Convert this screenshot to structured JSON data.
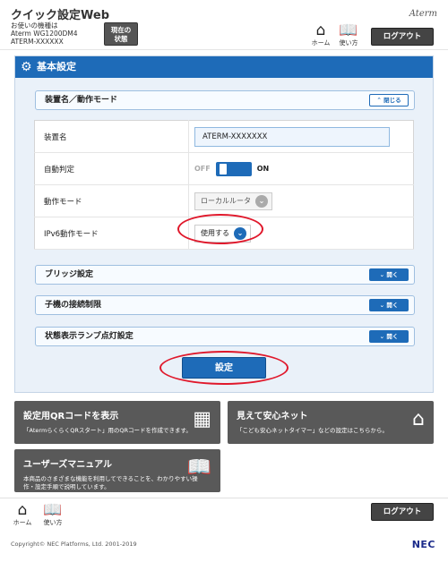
{
  "header": {
    "app_title": "クイック設定Web",
    "device_label": "お使いの機種は",
    "device_model": "Aterm WG1200DM4",
    "device_name": "ATERM-XXXXXX",
    "status_button_line1": "現在の",
    "status_button_line2": "状態",
    "brand": "Aterm",
    "home_label": "ホーム",
    "manual_label": "使い方",
    "logout_label": "ログアウト"
  },
  "panel": {
    "title": "基本設定",
    "sections": [
      {
        "title": "装置名／動作モード",
        "toggle_label": "閉じる",
        "expanded": true
      },
      {
        "title": "ブリッジ設定",
        "toggle_label": "開く",
        "expanded": false
      },
      {
        "title": "子機の接続制限",
        "toggle_label": "開く",
        "expanded": false
      },
      {
        "title": "状態表示ランプ点灯設定",
        "toggle_label": "開く",
        "expanded": false
      }
    ],
    "fields": {
      "device_name_label": "装置名",
      "device_name_value": "ATERM-XXXXXXX",
      "auto_detect_label": "自動判定",
      "auto_detect_off": "OFF",
      "auto_detect_on": "ON",
      "auto_detect_state": "ON",
      "mode_label": "動作モード",
      "mode_value": "ローカルルータ",
      "ipv6_label": "IPv6動作モード",
      "ipv6_value": "使用する"
    },
    "submit_label": "設定"
  },
  "tiles": {
    "qr_title": "設定用QRコードを表示",
    "qr_desc": "「AtermらくらくQRスタート」用のQRコードを作成できます。",
    "safety_title": "見えて安心ネット",
    "safety_desc": "「こども安心ネットタイマー」などの設定はこちらから。",
    "manual_title": "ユーザーズマニュアル",
    "manual_desc_line1": "本商品のさまざまな機能を利用してできることを、わかりやすい操",
    "manual_desc_line2": "作・設定手順で説明しています。"
  },
  "footer": {
    "home_label": "ホーム",
    "manual_label": "使い方",
    "logout_label": "ログアウト",
    "copyright": "Copyright© NEC Platforms, Ltd. 2001-2019",
    "nec": "NEC"
  },
  "colors": {
    "accent": "#1e6bb8",
    "highlight_oval": "#e0182b",
    "tile_bg": "#595959"
  }
}
